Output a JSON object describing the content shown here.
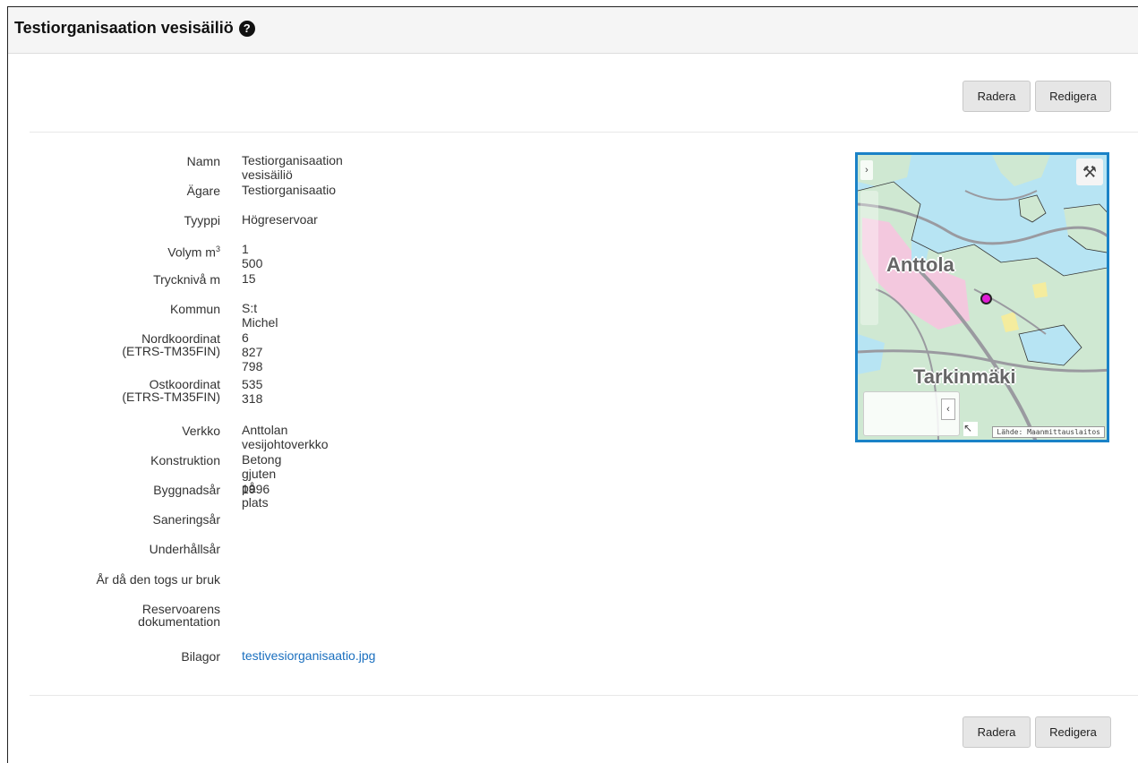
{
  "header": {
    "title": "Testiorganisaation vesisäiliö",
    "help_icon": "question-circle-icon"
  },
  "actions": {
    "delete_label": "Radera",
    "edit_label": "Redigera"
  },
  "details": [
    {
      "label": "Namn",
      "value": "Testiorganisaation vesisäiliö"
    },
    {
      "label": "Ägare",
      "value": "Testiorganisaatio"
    },
    {
      "label": "Tyyppi",
      "value": "Högreservoar"
    },
    {
      "label": "Volym m",
      "label_sup": "3",
      "value": "1 500"
    },
    {
      "label": "Trycknivå m",
      "value": "15"
    },
    {
      "label": "Kommun",
      "value": "S:t Michel"
    },
    {
      "label": "Nordkoordinat",
      "label_line2": "(ETRS-TM35FIN)",
      "value": "6 827 798"
    },
    {
      "label": "Ostkoordinat",
      "label_line2": "(ETRS-TM35FIN)",
      "value": "535 318"
    },
    {
      "label": "Verkko",
      "value": "Anttolan vesijohtoverkko"
    },
    {
      "label": "Konstruktion",
      "value": "Betong gjuten på plats"
    },
    {
      "label": "Byggnadsår",
      "value": "1996"
    },
    {
      "label": "Saneringsår",
      "value": ""
    },
    {
      "label": "Underhållsår",
      "value": ""
    },
    {
      "label": "År då den togs ur bruk",
      "value": ""
    },
    {
      "label": "Reservoarens",
      "label_line2": "dokumentation",
      "value": ""
    },
    {
      "label": "Bilagor",
      "value": "testivesiorganisaatio.jpg"
    }
  ],
  "map": {
    "place_labels": [
      "Anttola",
      "Tarkinmäki"
    ],
    "attribution": "Lähde: Maanmittauslaitos",
    "marker_color": "#e11fd6",
    "water_color": "#b7e4f3",
    "land_color": "#cfe8d2",
    "urban_color": "#f3c8de",
    "tools_icon": "tools-icon"
  }
}
